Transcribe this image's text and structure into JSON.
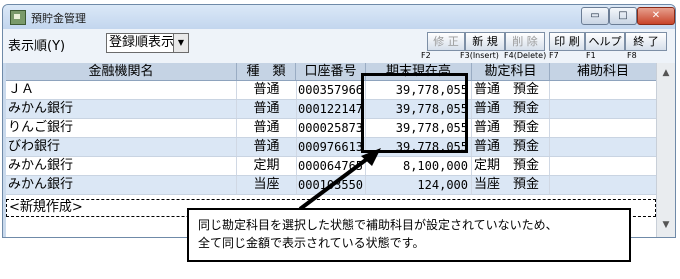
{
  "window": {
    "title": "預貯金管理",
    "minimize_glyph": "▭",
    "maximize_glyph": "□",
    "close_glyph": "✕"
  },
  "toolbar": {
    "sort_label": "表示順(Y)",
    "sort_value": "登録順表示",
    "dropdown_glyph": "▼",
    "buttons": [
      {
        "label": "修 正",
        "fkey": "F2",
        "enabled": false
      },
      {
        "label": "新 規",
        "fkey": "F3(Insert)",
        "enabled": true
      },
      {
        "label": "削 除",
        "fkey": "F4(Delete)",
        "enabled": false
      },
      {
        "label": "印 刷",
        "fkey": "F7",
        "enabled": true
      },
      {
        "label": "ヘルプ",
        "fkey": "F1",
        "enabled": true
      },
      {
        "label": "終 了",
        "fkey": "F8",
        "enabled": true
      }
    ]
  },
  "table": {
    "columns": [
      "金融機関名",
      "種　類",
      "口座番号",
      "期末現在高",
      "勘定科目",
      "補助科目"
    ],
    "rows": [
      [
        "ＪＡ",
        "普通",
        "000357966",
        "39,778,055",
        "普通　預金",
        ""
      ],
      [
        "みかん銀行",
        "普通",
        "000122147",
        "39,778,055",
        "普通　預金",
        ""
      ],
      [
        "りんご銀行",
        "普通",
        "000025873",
        "39,778,055",
        "普通　預金",
        ""
      ],
      [
        "びわ銀行",
        "普通",
        "000976613",
        "39,778,055",
        "普通　預金",
        ""
      ],
      [
        "みかん銀行",
        "定期",
        "000064765",
        "8,100,000",
        "定期　預金",
        ""
      ],
      [
        "みかん銀行",
        "当座",
        "000103550",
        "124,000",
        "当座　預金",
        ""
      ]
    ],
    "new_row_label": "<新規作成>"
  },
  "scrollbar": {
    "up_glyph": "▲",
    "down_glyph": "▼"
  },
  "callout": {
    "line1": "同じ勘定科目を選択した状態で補助科目が設定されていないため、",
    "line2": "全て同じ金額で表示されている状態です。"
  },
  "colors": {
    "header_bg": "#c5d3e4",
    "row_alt_bg": "#dbe7f5",
    "highlight_border": "#000000"
  }
}
